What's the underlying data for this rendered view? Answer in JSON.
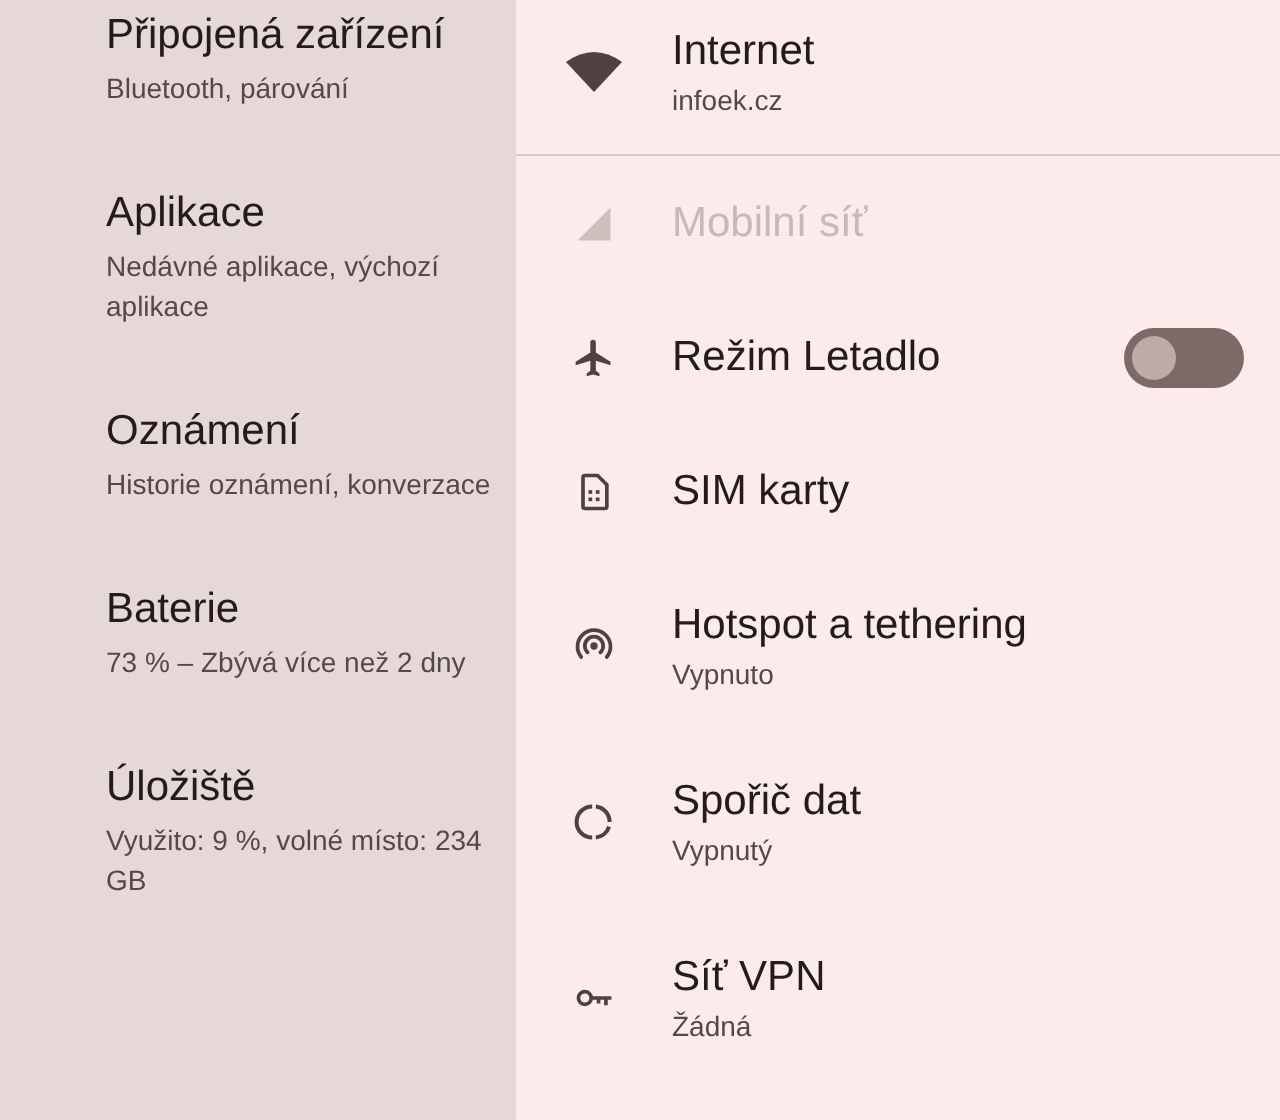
{
  "sidebar": {
    "items": [
      {
        "title": "Připojená zařízení",
        "subtitle": "Bluetooth, párování"
      },
      {
        "title": "Aplikace",
        "subtitle": "Nedávné aplikace, výchozí aplikace"
      },
      {
        "title": "Oznámení",
        "subtitle": "Historie oznámení, konverzace"
      },
      {
        "title": "Baterie",
        "subtitle": "73 % – Zbývá více než 2 dny"
      },
      {
        "title": "Úložiště",
        "subtitle": "Využito: 9 %, volné místo: 234 GB"
      }
    ]
  },
  "connection": {
    "title": "Internet",
    "subtitle": "infoek.cz"
  },
  "items": [
    {
      "kind": "link",
      "title": "Mobilní síť",
      "disabled": true
    },
    {
      "kind": "toggle",
      "title": "Režim Letadlo",
      "on": false,
      "disabled": false
    },
    {
      "kind": "link",
      "title": "SIM karty",
      "disabled": false
    },
    {
      "kind": "link",
      "title": "Hotspot a tethering",
      "subtitle": "Vypnuto",
      "disabled": false
    },
    {
      "kind": "link",
      "title": "Spořič dat",
      "subtitle": "Vypnutý",
      "disabled": false
    },
    {
      "kind": "link",
      "title": "Síť VPN",
      "subtitle": "Žádná",
      "disabled": false
    }
  ]
}
